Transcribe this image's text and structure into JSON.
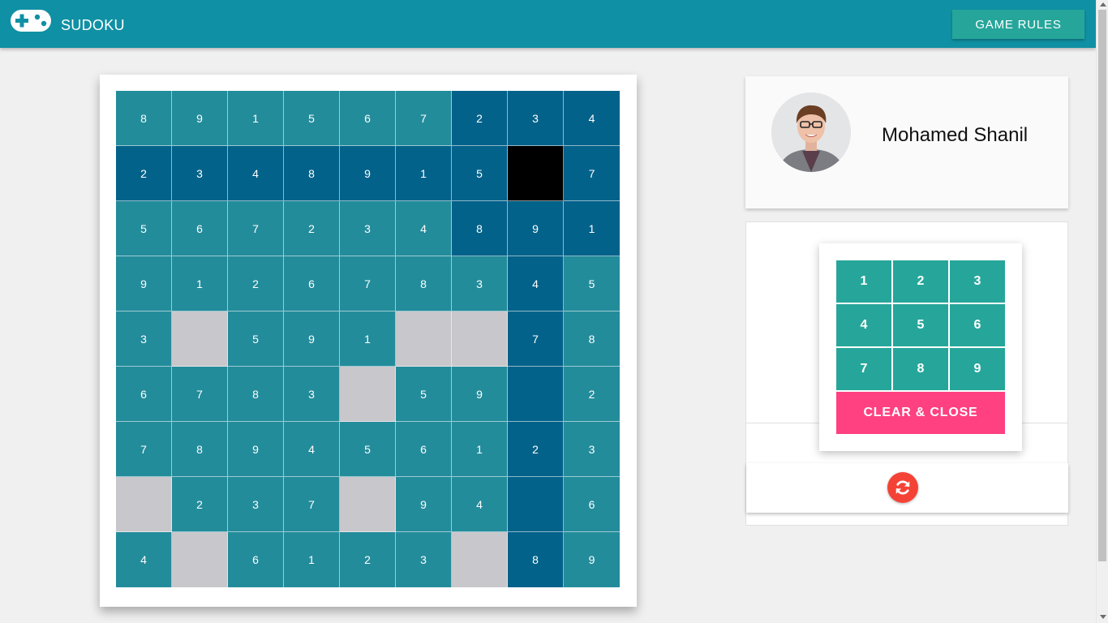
{
  "header": {
    "title": "SUDOKU",
    "logo_icon": "gamepad-icon",
    "rules_label": "GAME RULES"
  },
  "colors": {
    "app_bar": "#1090a4",
    "cell_normal": "#238c9b",
    "cell_highlight": "#03628a",
    "cell_empty": "#c8c7cb",
    "cell_selected": "#000000",
    "accent_teal": "#26a69a",
    "accent_pink": "#ff4081",
    "reset_red": "#f44336"
  },
  "board": {
    "rows": [
      [
        "8",
        "9",
        "1",
        "5",
        "6",
        "7",
        "2",
        "3",
        "4"
      ],
      [
        "2",
        "3",
        "4",
        "8",
        "9",
        "1",
        "5",
        "",
        "7"
      ],
      [
        "5",
        "6",
        "7",
        "2",
        "3",
        "4",
        "8",
        "9",
        "1"
      ],
      [
        "9",
        "1",
        "2",
        "6",
        "7",
        "8",
        "3",
        "4",
        "5"
      ],
      [
        "3",
        "",
        "5",
        "9",
        "1",
        "",
        "",
        "7",
        "8"
      ],
      [
        "6",
        "7",
        "8",
        "3",
        "",
        "5",
        "9",
        "",
        "2"
      ],
      [
        "7",
        "8",
        "9",
        "4",
        "5",
        "6",
        "1",
        "2",
        "3"
      ],
      [
        "",
        "2",
        "3",
        "7",
        "",
        "9",
        "4",
        "",
        "6"
      ],
      [
        "4",
        "",
        "6",
        "1",
        "2",
        "3",
        "",
        "8",
        "9"
      ]
    ],
    "selected": [
      1,
      7
    ]
  },
  "profile": {
    "name": "Mohamed Shanil",
    "avatar_icon": "avatar"
  },
  "numpad": {
    "keys": [
      "1",
      "2",
      "3",
      "4",
      "5",
      "6",
      "7",
      "8",
      "9"
    ],
    "clear_label": "CLEAR & CLOSE"
  },
  "reset": {
    "icon": "refresh-icon"
  }
}
